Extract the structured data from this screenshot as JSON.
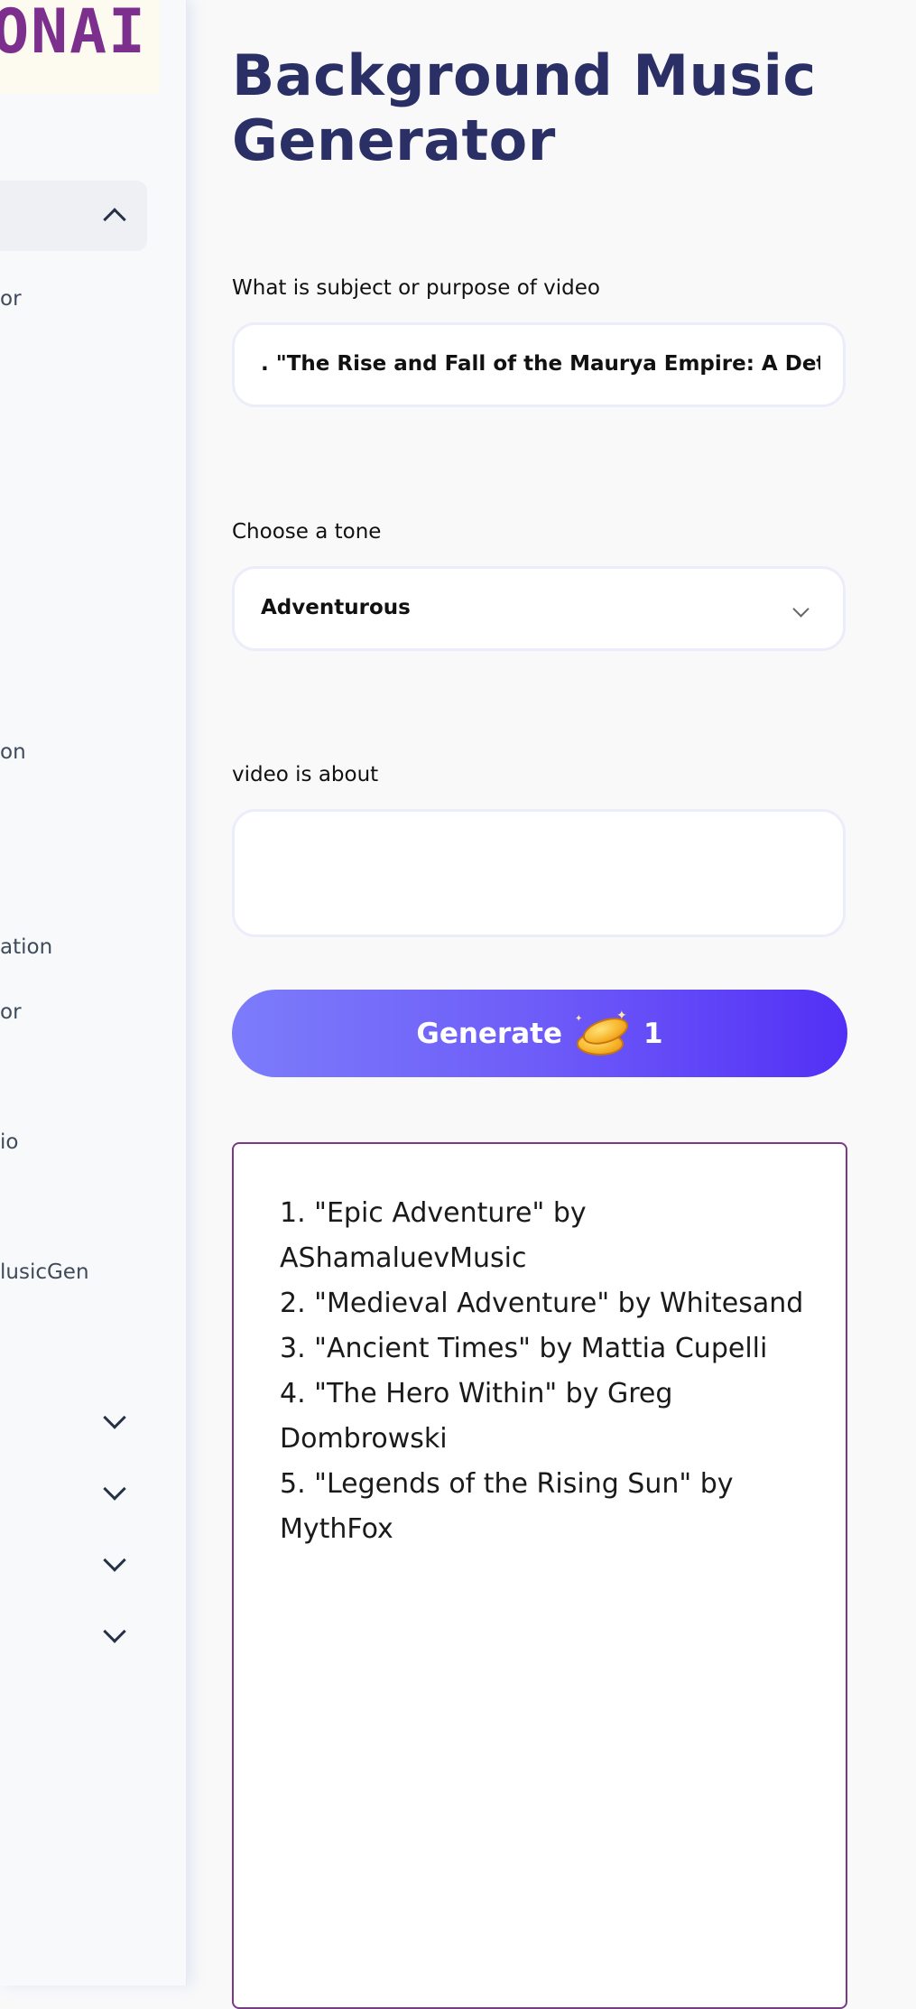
{
  "sidebar": {
    "logo_text": "ONAI",
    "items": [
      {
        "label": "or"
      },
      {
        "label": "on"
      },
      {
        "label": "ation"
      },
      {
        "label": "or"
      },
      {
        "label": "io"
      },
      {
        "label": "lusicGen"
      }
    ]
  },
  "page": {
    "title": "Background Music Generator"
  },
  "form": {
    "subject_label": "What is subject or purpose of video",
    "subject_value": ". \"The Rise and Fall of the Maurya Empire: A Detailed",
    "tone_label": "Choose a tone",
    "tone_value": "Adventurous",
    "about_label": "video is about",
    "about_value": "",
    "generate_label": "Generate",
    "generate_cost": "1"
  },
  "result": {
    "items": [
      "1. \"Epic Adventure\" by AShamaluevMusic",
      "2. \"Medieval Adventure\" by Whitesand",
      "3. \"Ancient Times\" by Mattia Cupelli",
      "4. \"The Hero Within\" by Greg Dombrowski",
      "5. \"Legends of the Rising Sun\" by MythFox"
    ]
  },
  "colors": {
    "brand_purple": "#7d2f8e",
    "title_navy": "#2a2f66",
    "button_gradient_start": "#7c7cfb",
    "button_gradient_end": "#5330f6"
  }
}
